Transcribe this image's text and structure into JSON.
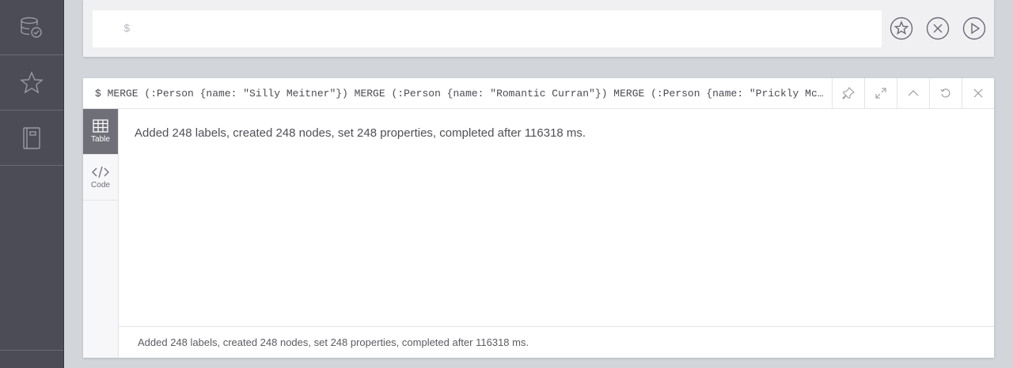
{
  "sidebar": {
    "items": [
      {
        "icon": "database-icon"
      },
      {
        "icon": "star-icon"
      },
      {
        "icon": "book-icon"
      }
    ]
  },
  "editor": {
    "prompt": "$",
    "actions": [
      {
        "icon": "favorite-star-icon"
      },
      {
        "icon": "clear-x-icon"
      },
      {
        "icon": "run-play-icon"
      }
    ]
  },
  "frame": {
    "query": "$ MERGE (:Person {name: \"Silly Meitner\"}) MERGE (:Person {name: \"Romantic Curran\"}) MERGE (:Person {name: \"Prickly Mc…",
    "controls": [
      "pin-icon",
      "expand-icon",
      "collapse-icon",
      "rerun-icon",
      "close-icon"
    ],
    "tabs": [
      {
        "label": "Table",
        "icon": "table-icon",
        "active": true
      },
      {
        "label": "Code",
        "icon": "code-icon",
        "active": false
      }
    ],
    "message": "Added 248 labels, created 248 nodes, set 248 properties, completed after 116318 ms.",
    "footer": "Added 248 labels, created 248 nodes, set 248 properties, completed after 116318 ms."
  },
  "colors": {
    "sidebar_bg": "#4c4c56",
    "page_bg": "#d2d5da",
    "active_tab": "#6f6f77"
  }
}
